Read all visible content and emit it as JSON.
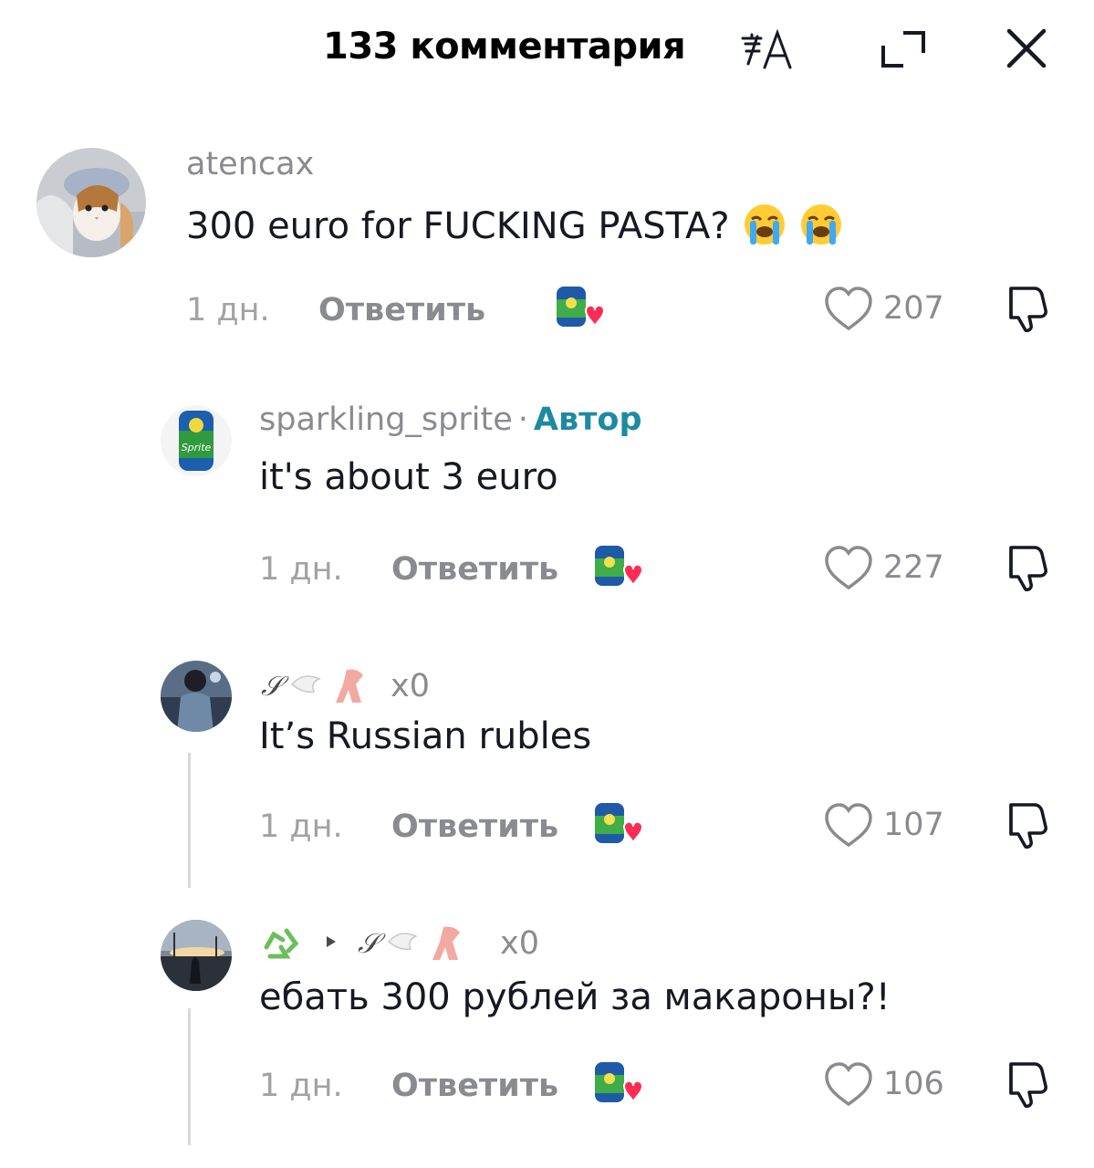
{
  "header": {
    "title": "133 комментария",
    "translate_icon": "translate-icon",
    "expand_icon": "expand-icon",
    "close_icon": "close-icon"
  },
  "comments": [
    {
      "username": "atencax",
      "text": "300 euro for FUCKING PASTA?",
      "emoji": "😭😭",
      "time": "1 дн.",
      "reply": "Ответить",
      "likes": "207"
    },
    {
      "username": "sparkling_sprite",
      "author_separator": "·",
      "author_label": "Автор",
      "text": "it's about 3 euro",
      "time": "1 дн.",
      "reply": "Ответить",
      "likes": "227"
    },
    {
      "username": "x0",
      "text": "It’s Russian rubles",
      "time": "1 дн.",
      "reply": "Ответить",
      "likes": "107"
    },
    {
      "username": "x0",
      "text": "ебать 300 рублей за макароны?!",
      "time": "1 дн.",
      "reply": "Ответить",
      "likes": "106"
    }
  ],
  "colors": {
    "author_badge": "#1d8aa1",
    "secondary_text": "#8a8b91",
    "primary_text": "#161823",
    "creator_heart": "#fe2c55"
  }
}
